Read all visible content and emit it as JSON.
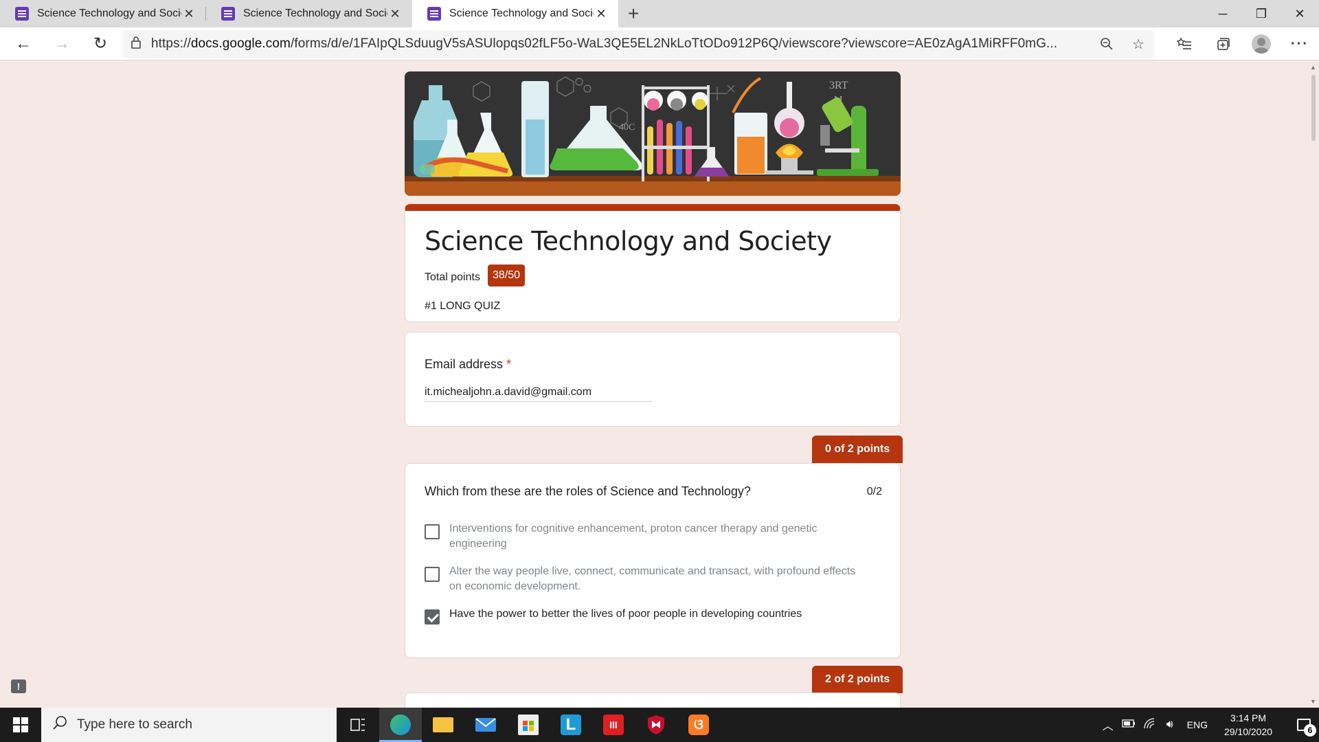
{
  "browser": {
    "tabs": [
      {
        "title": "Science Technology and Society",
        "active": false
      },
      {
        "title": "Science Technology and Society",
        "active": false
      },
      {
        "title": "Science Technology and Society",
        "active": true
      }
    ],
    "url_prefix": "https://",
    "url_host": "docs.google.com",
    "url_path": "/forms/d/e/1FAIpQLSduugV5sASUlopqs02fLF5o-WaL3QE5EL2NkLoTtODo912P6Q/viewscore?viewscore=AE0zAgA1MiRFF0mG..."
  },
  "form": {
    "title": "Science Technology and Society",
    "total_points_label": "Total points",
    "score": "38/50",
    "description": "#1 LONG QUIZ",
    "email": {
      "label": "Email address",
      "required_mark": "*",
      "value": "it.michealjohn.a.david@gmail.com"
    },
    "questions": [
      {
        "points_header": "0 of 2 points",
        "text": "Which from these are the roles of Science and Technology?",
        "score": "0/2",
        "options": [
          {
            "text": "Interventions for cognitive enhancement, proton cancer therapy and genetic engineering",
            "checked": false
          },
          {
            "text": "Alter the way people live, connect, communicate and transact, with profound effects on economic development.",
            "checked": false
          },
          {
            "text": "Have the power to better the lives of poor people in developing countries",
            "checked": true
          }
        ]
      },
      {
        "points_header": "2 of 2 points"
      }
    ]
  },
  "taskbar": {
    "search_placeholder": "Type here to search",
    "language": "ENG",
    "time": "3:14 PM",
    "date": "29/10/2020",
    "notification_count": "6"
  },
  "colors": {
    "accent": "#b5360e",
    "page_background": "#f6e8e4",
    "forms_icon": "#673ab7"
  }
}
